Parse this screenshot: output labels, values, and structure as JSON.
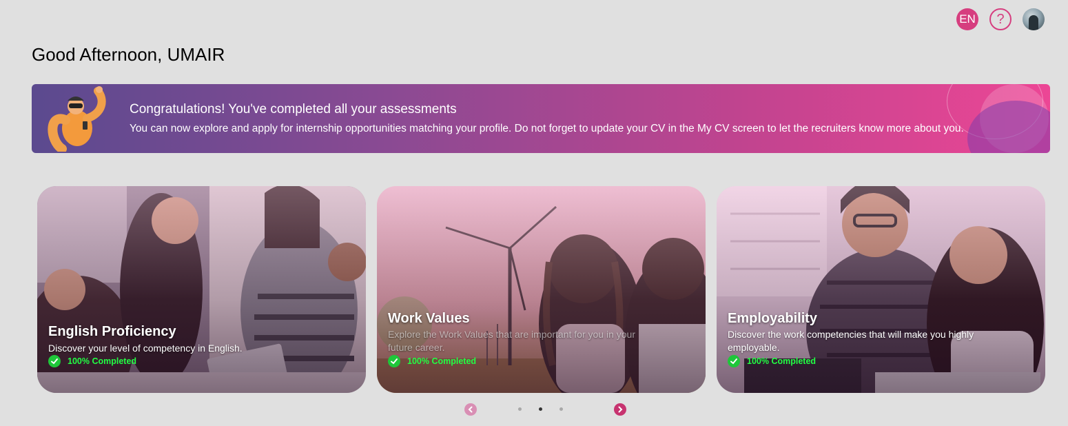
{
  "header": {
    "language_label": "EN",
    "help_label": "?",
    "greeting": "Good Afternoon, UMAIR"
  },
  "banner": {
    "title": "Congratulations! You've completed all your assessments",
    "text": "You can now explore and apply for internship opportunities matching your profile. Do not forget to update your CV in the My CV screen to let the recruiters know more about you."
  },
  "cards": [
    {
      "title": "English Proficiency",
      "description": "Discover your level of competency in English.",
      "status": "100% Completed"
    },
    {
      "title": "Work Values",
      "description": "Explore the Work Values that are important for you in your future career.",
      "status": "100% Completed"
    },
    {
      "title": "Employability",
      "description": "Discover the work competencies that will make you highly employable.",
      "status": "100% Completed"
    }
  ],
  "carousel": {
    "active_index": 2,
    "dot_count": 3
  },
  "colors": {
    "accent": "#d63e7f",
    "success": "#22ff44",
    "background": "#e0e0e0"
  }
}
